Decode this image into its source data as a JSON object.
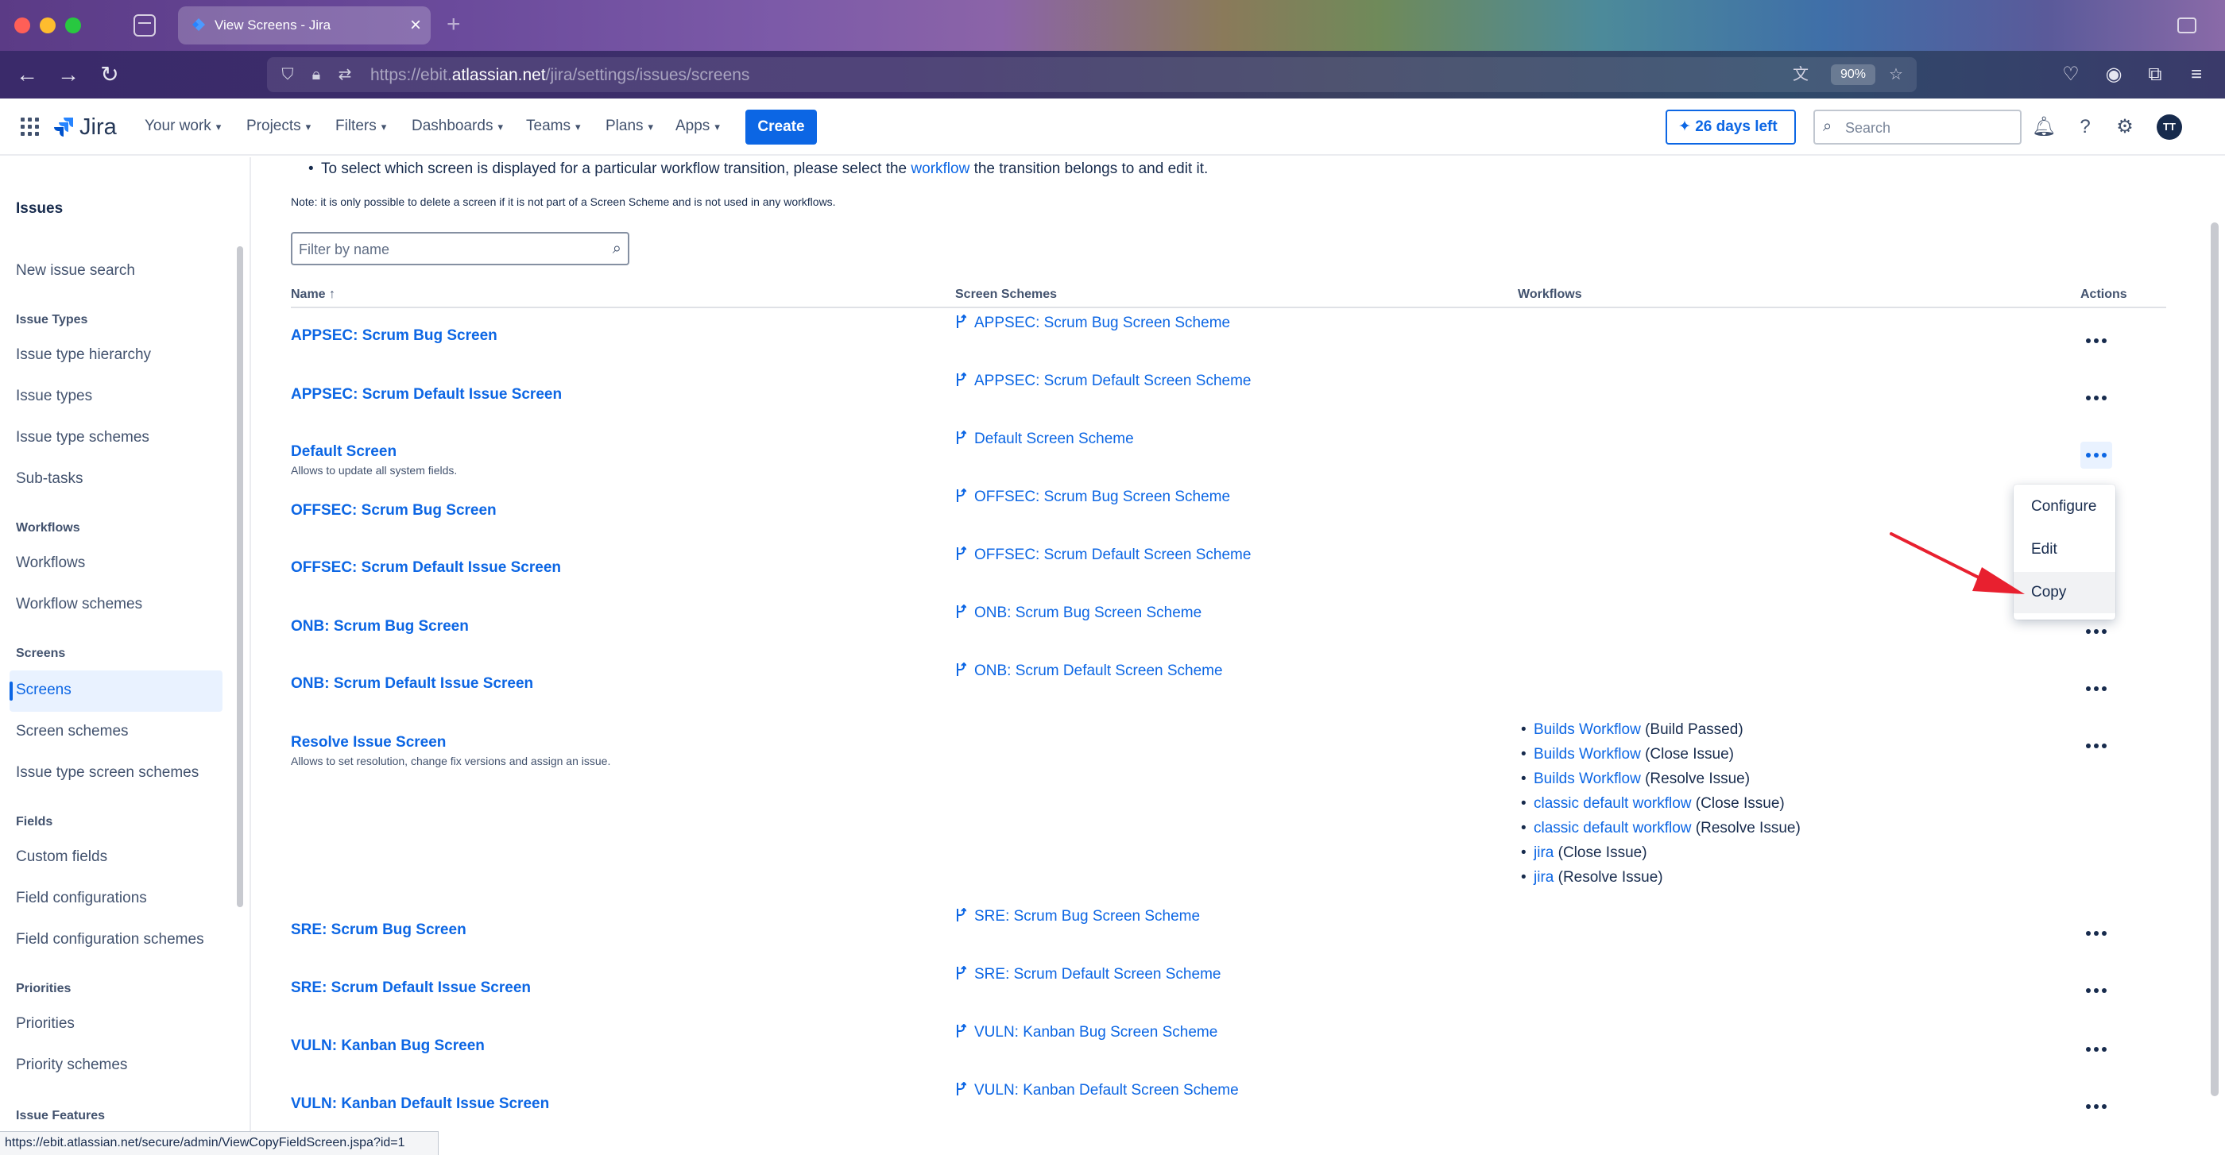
{
  "browser": {
    "tab_title": "View Screens - Jira",
    "url_prefix": "https://ebit.",
    "url_domain": "atlassian.net",
    "url_path": "/jira/settings/issues/screens",
    "zoom": "90%",
    "status_url": "https://ebit.atlassian.net/secure/admin/ViewCopyFieldScreen.jspa?id=1"
  },
  "topnav": {
    "logo": "Jira",
    "items": [
      "Your work",
      "Projects",
      "Filters",
      "Dashboards",
      "Teams",
      "Plans",
      "Apps"
    ],
    "create": "Create",
    "trial": "26 days left",
    "search_placeholder": "Search",
    "avatar": "TT"
  },
  "sidebar": {
    "title": "Issues",
    "new_issue_search": "New issue search",
    "sections": [
      {
        "header": "Issue Types",
        "items": [
          "Issue type hierarchy",
          "Issue types",
          "Issue type schemes",
          "Sub-tasks"
        ]
      },
      {
        "header": "Workflows",
        "items": [
          "Workflows",
          "Workflow schemes"
        ]
      },
      {
        "header": "Screens",
        "items": [
          "Screens",
          "Screen schemes",
          "Issue type screen schemes"
        ]
      },
      {
        "header": "Fields",
        "items": [
          "Custom fields",
          "Field configurations",
          "Field configuration schemes"
        ]
      },
      {
        "header": "Priorities",
        "items": [
          "Priorities",
          "Priority schemes"
        ]
      },
      {
        "header": "Issue Features",
        "items": []
      }
    ],
    "active_item": "Screens"
  },
  "main": {
    "bullet_before": "To select which screen is displayed for a particular workflow transition, please select the ",
    "bullet_link": "workflow",
    "bullet_after": " the transition belongs to and edit it.",
    "note": "Note: it is only possible to delete a screen if it is not part of a Screen Scheme and is not used in any workflows.",
    "filter_placeholder": "Filter by name",
    "columns": {
      "name": "Name ↑",
      "schemes": "Screen Schemes",
      "workflows": "Workflows",
      "actions": "Actions"
    },
    "rows": [
      {
        "name": "APPSEC: Scrum Bug Screen",
        "desc": "",
        "scheme": "APPSEC: Scrum Bug Screen Scheme"
      },
      {
        "name": "APPSEC: Scrum Default Issue Screen",
        "desc": "",
        "scheme": "APPSEC: Scrum Default Screen Scheme"
      },
      {
        "name": "Default Screen",
        "desc": "Allows to update all system fields.",
        "scheme": "Default Screen Scheme"
      },
      {
        "name": "OFFSEC: Scrum Bug Screen",
        "desc": "",
        "scheme": "OFFSEC: Scrum Bug Screen Scheme"
      },
      {
        "name": "OFFSEC: Scrum Default Issue Screen",
        "desc": "",
        "scheme": "OFFSEC: Scrum Default Screen Scheme"
      },
      {
        "name": "ONB: Scrum Bug Screen",
        "desc": "",
        "scheme": "ONB: Scrum Bug Screen Scheme"
      },
      {
        "name": "ONB: Scrum Default Issue Screen",
        "desc": "",
        "scheme": "ONB: Scrum Default Screen Scheme"
      },
      {
        "name": "Resolve Issue Screen",
        "desc": "Allows to set resolution, change fix versions and assign an issue.",
        "scheme": ""
      },
      {
        "name": "SRE: Scrum Bug Screen",
        "desc": "",
        "scheme": "SRE: Scrum Bug Screen Scheme"
      },
      {
        "name": "SRE: Scrum Default Issue Screen",
        "desc": "",
        "scheme": "SRE: Scrum Default Screen Scheme"
      },
      {
        "name": "VULN: Kanban Bug Screen",
        "desc": "",
        "scheme": "VULN: Kanban Bug Screen Scheme"
      },
      {
        "name": "VULN: Kanban Default Issue Screen",
        "desc": "",
        "scheme": "VULN: Kanban Default Screen Scheme"
      }
    ],
    "workflows": [
      {
        "link": "Builds Workflow",
        "suffix": " (Build Passed)"
      },
      {
        "link": "Builds Workflow",
        "suffix": " (Close Issue)"
      },
      {
        "link": "Builds Workflow",
        "suffix": " (Resolve Issue)"
      },
      {
        "link": "classic default workflow",
        "suffix": " (Close Issue)"
      },
      {
        "link": "classic default workflow",
        "suffix": " (Resolve Issue)"
      },
      {
        "link": "jira",
        "suffix": " (Close Issue)"
      },
      {
        "link": "jira",
        "suffix": " (Resolve Issue)"
      }
    ],
    "menu": [
      "Configure",
      "Edit",
      "Copy"
    ]
  },
  "colors": {
    "accent": "#0c66e4",
    "annotation_arrow": "#e8202f"
  }
}
